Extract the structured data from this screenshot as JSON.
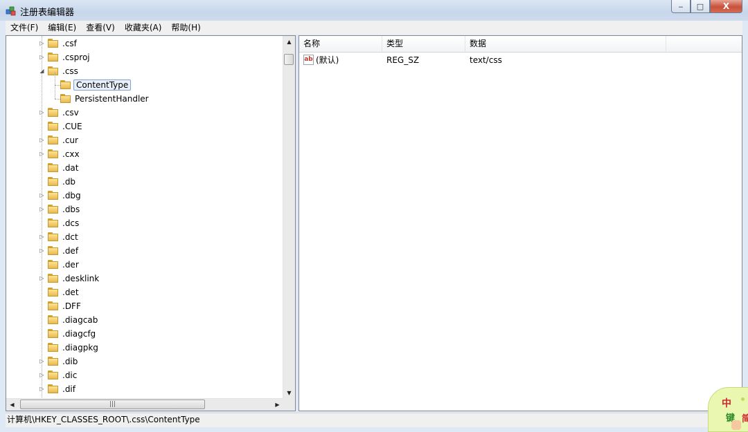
{
  "window": {
    "title": "注册表编辑器",
    "controls": {
      "minimize": "‒",
      "maximize": "□",
      "close": "X"
    }
  },
  "menu": {
    "items": [
      "文件(F)",
      "编辑(E)",
      "查看(V)",
      "收藏夹(A)",
      "帮助(H)"
    ]
  },
  "tree": {
    "nodes": [
      {
        "label": ".csf",
        "expander": "collapsed",
        "level": 0
      },
      {
        "label": ".csproj",
        "expander": "collapsed",
        "level": 0
      },
      {
        "label": ".css",
        "expander": "expanded",
        "level": 0
      },
      {
        "label": "ContentType",
        "expander": "none",
        "level": 1,
        "selected": true
      },
      {
        "label": "PersistentHandler",
        "expander": "none",
        "level": 1
      },
      {
        "label": ".csv",
        "expander": "collapsed",
        "level": 0
      },
      {
        "label": ".CUE",
        "expander": "none",
        "level": 0
      },
      {
        "label": ".cur",
        "expander": "collapsed",
        "level": 0
      },
      {
        "label": ".cxx",
        "expander": "collapsed",
        "level": 0
      },
      {
        "label": ".dat",
        "expander": "none",
        "level": 0
      },
      {
        "label": ".db",
        "expander": "none",
        "level": 0
      },
      {
        "label": ".dbg",
        "expander": "collapsed",
        "level": 0
      },
      {
        "label": ".dbs",
        "expander": "collapsed",
        "level": 0
      },
      {
        "label": ".dcs",
        "expander": "none",
        "level": 0
      },
      {
        "label": ".dct",
        "expander": "collapsed",
        "level": 0
      },
      {
        "label": ".def",
        "expander": "collapsed",
        "level": 0
      },
      {
        "label": ".der",
        "expander": "none",
        "level": 0
      },
      {
        "label": ".desklink",
        "expander": "collapsed",
        "level": 0
      },
      {
        "label": ".det",
        "expander": "none",
        "level": 0
      },
      {
        "label": ".DFF",
        "expander": "none",
        "level": 0
      },
      {
        "label": ".diagcab",
        "expander": "none",
        "level": 0
      },
      {
        "label": ".diagcfg",
        "expander": "none",
        "level": 0
      },
      {
        "label": ".diagpkg",
        "expander": "none",
        "level": 0
      },
      {
        "label": ".dib",
        "expander": "collapsed",
        "level": 0
      },
      {
        "label": ".dic",
        "expander": "collapsed",
        "level": 0
      },
      {
        "label": ".dif",
        "expander": "collapsed",
        "level": 0
      }
    ],
    "scroll": {
      "up": "▲",
      "down": "▼",
      "left": "◀",
      "right": "▶",
      "grip": "|||"
    }
  },
  "values": {
    "columns": [
      "名称",
      "类型",
      "数据"
    ],
    "rows": [
      {
        "icon": "ab",
        "name": "(默认)",
        "type": "REG_SZ",
        "data": "text/css"
      }
    ]
  },
  "status": {
    "path": "计算机\\HKEY_CLASSES_ROOT\\.css\\ContentType"
  },
  "ime": {
    "chars": [
      "中",
      "键",
      "简"
    ]
  }
}
